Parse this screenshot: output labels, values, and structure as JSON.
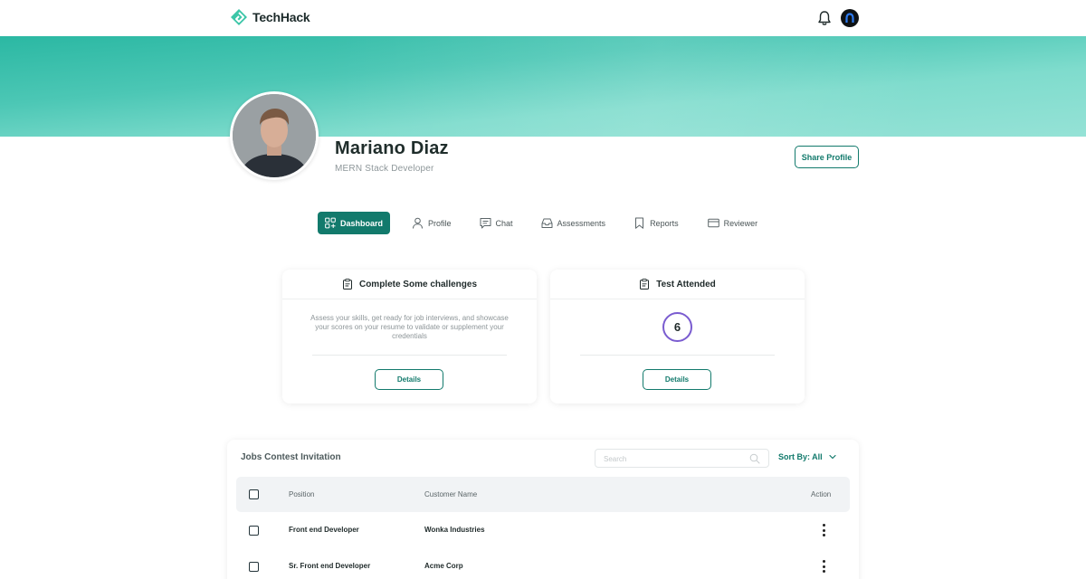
{
  "app": {
    "name": "TechHack"
  },
  "profile": {
    "name": "Mariano Diaz",
    "role": "MERN Stack Developer",
    "share_label": "Share Profile"
  },
  "tabs": [
    {
      "label": "Dashboard",
      "icon": "dashboard-icon",
      "active": true
    },
    {
      "label": "Profile",
      "icon": "user-icon",
      "active": false
    },
    {
      "label": "Chat",
      "icon": "chat-icon",
      "active": false
    },
    {
      "label": "Assessments",
      "icon": "inbox-icon",
      "active": false
    },
    {
      "label": "Reports",
      "icon": "bookmark-icon",
      "active": false
    },
    {
      "label": "Reviewer",
      "icon": "card-icon",
      "active": false
    }
  ],
  "cards": {
    "challenges": {
      "title": "Complete Some challenges",
      "description": "Assess your skills, get ready for job interviews, and showcase your scores on your resume to validate or supplement your credentials",
      "button": "Details"
    },
    "tests": {
      "title": "Test Attended",
      "count": "6",
      "button": "Details"
    }
  },
  "jobs": {
    "title": "Jobs Contest Invitation",
    "search_placeholder": "Search",
    "sort_label": "Sort By: All",
    "columns": {
      "position": "Position",
      "customer": "Customer Name",
      "action": "Action"
    },
    "rows": [
      {
        "position": "Front end Developer",
        "customer": "Wonka Industries"
      },
      {
        "position": "Sr. Front end Developer",
        "customer": "Acme Corp"
      }
    ]
  },
  "colors": {
    "accent": "#127a6c",
    "banner": "#4cc7b5",
    "count_ring": "#7a5cd0"
  }
}
